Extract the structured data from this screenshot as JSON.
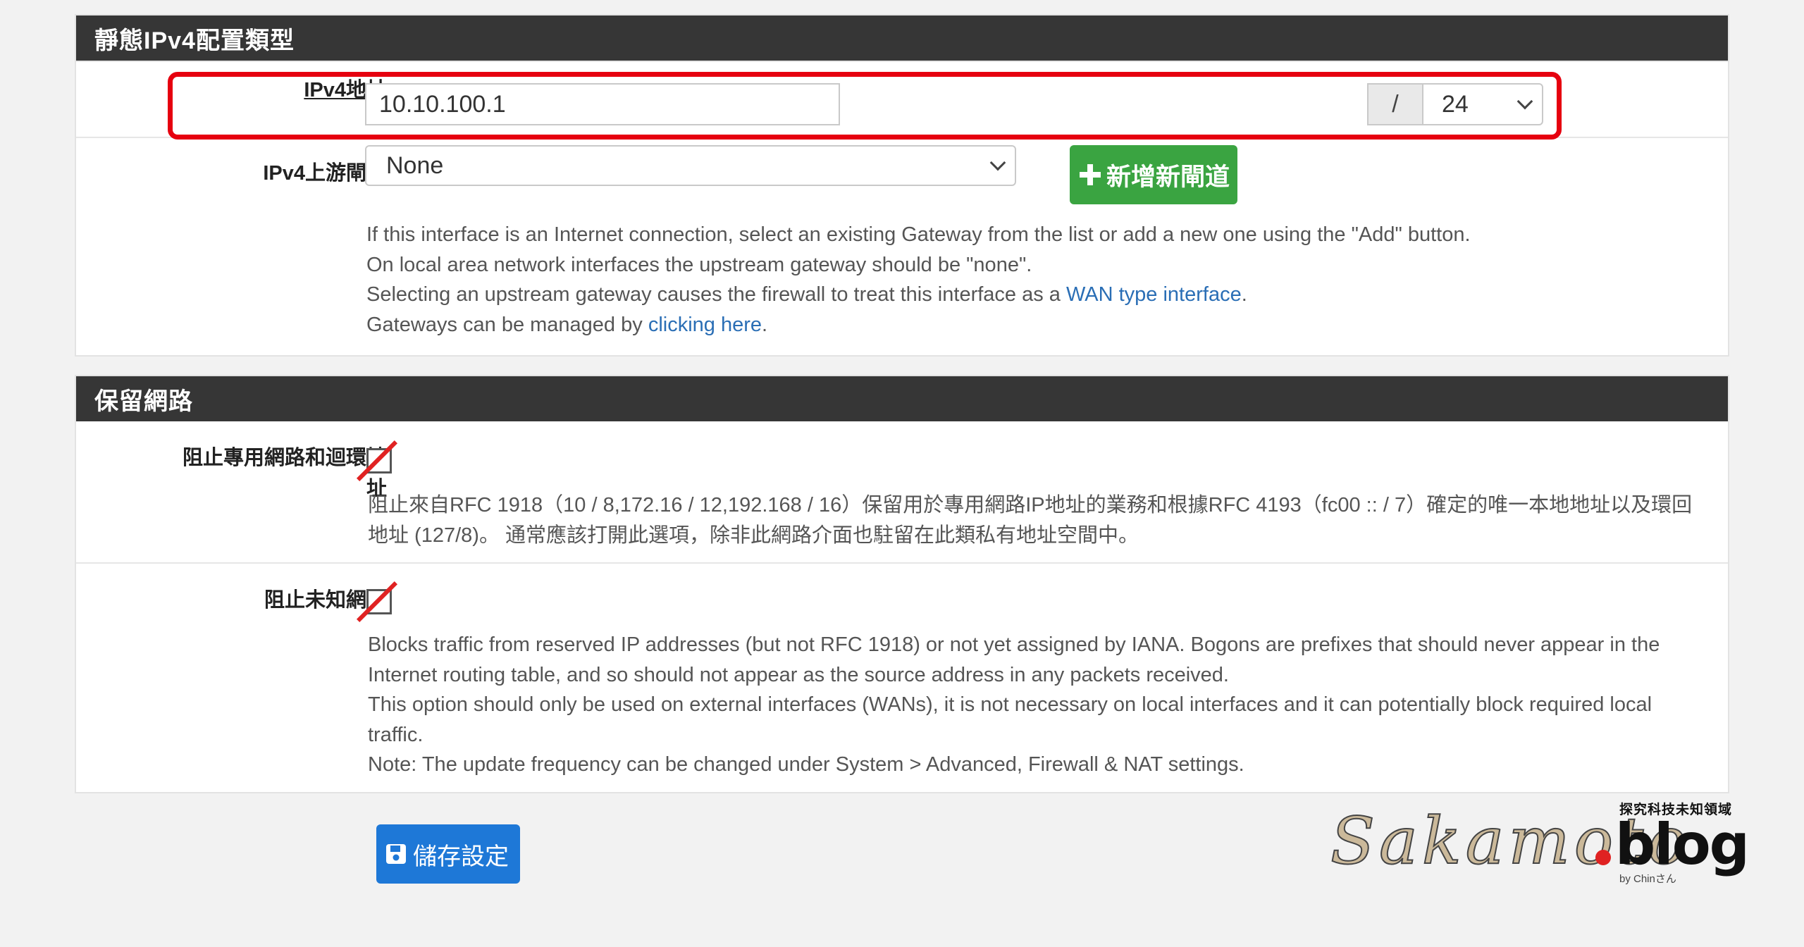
{
  "static_ipv4": {
    "header": "靜態IPv4配置類型",
    "address_label": "IPv4地址",
    "address_value": "10.10.100.1",
    "cidr_slash": "/",
    "cidr_value": "24",
    "gateway_label": "IPv4上游閘道",
    "gateway_value": "None",
    "add_gateway_button": "新增新閘道",
    "help_line1": "If this interface is an Internet connection, select an existing Gateway from the list or add a new one using the \"Add\" button.",
    "help_line2": "On local area network interfaces the upstream gateway should be \"none\".",
    "help_line3_prefix": "Selecting an upstream gateway causes the firewall to treat this interface as a ",
    "help_line3_link": "WAN type interface",
    "help_line3_suffix": ".",
    "help_line4_prefix": "Gateways can be managed by ",
    "help_line4_link": "clicking here",
    "help_line4_suffix": "."
  },
  "reserved_networks": {
    "header": "保留網路",
    "block_private_label_line1": "阻止專用網路和迴環地",
    "block_private_label_line2": "址",
    "block_private_help_line1": "阻止來自RFC 1918（10 / 8,172.16 / 12,192.168 / 16）保留用於專用網路IP地址的業務和根據RFC 4193（fc00 :: / 7）確定的唯一本地地址以及環回",
    "block_private_help_line2": "地址 (127/8)。 通常應該打開此選項，除非此網路介面也駐留在此類私有地址空間中。",
    "block_bogon_label": "阻止未知網路",
    "block_bogon_help_line1": "Blocks traffic from reserved IP addresses (but not RFC 1918) or not yet assigned by IANA. Bogons are prefixes that should never appear in the",
    "block_bogon_help_line2": "Internet routing table, and so should not appear as the source address in any packets received.",
    "block_bogon_help_line3": "This option should only be used on external interfaces (WANs), it is not necessary on local interfaces and it can potentially block required local",
    "block_bogon_help_line4": "traffic.",
    "block_bogon_help_line5": "Note: The update frequency can be changed under System > Advanced, Firewall & NAT settings."
  },
  "save_button": "儲存設定",
  "watermark": {
    "name": "Sakamoto",
    "suffix": "blog",
    "tagline": "探究科技未知領域",
    "by": "by Chinさん"
  },
  "colors": {
    "header_bg": "#363636",
    "link": "#2a6eb5",
    "green_button": "#3aa441",
    "blue_button": "#1e78d7",
    "highlight": "#e6000f"
  },
  "icons": {
    "add_icon": "plus-icon",
    "save_icon": "floppy-disk-icon",
    "dropdown_icon": "chevron-down-icon"
  }
}
